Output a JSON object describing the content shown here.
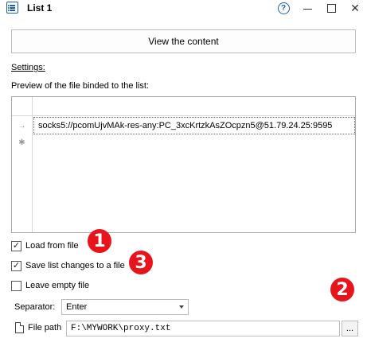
{
  "window": {
    "title": "List 1",
    "help_glyph": "?",
    "close_glyph": "✕"
  },
  "main": {
    "view_button_label": "View the content",
    "settings_label": "Settings:",
    "preview_label": "Preview of the file binded to the list:",
    "grid": {
      "rows": [
        {
          "indicator": "→",
          "value": "socks5://pcomUjvMAk-res-any:PC_3xcKrtzkAsZOcpzn5@51.79.24.25:9595"
        },
        {
          "indicator": "✱",
          "value": ""
        }
      ]
    }
  },
  "options": {
    "load_from_file": {
      "label": "Load from file",
      "checked": true
    },
    "save_changes": {
      "label": "Save list changes to a file",
      "checked": true
    },
    "leave_empty": {
      "label": "Leave empty file",
      "checked": false
    },
    "check_glyph": "✓"
  },
  "separator": {
    "label": "Separator:",
    "value": "Enter"
  },
  "file_path": {
    "label": "File path",
    "value": "F:\\MYWORK\\proxy.txt",
    "browse_label": "..."
  },
  "annotations": {
    "badge1": "1",
    "badge2": "2",
    "badge3": "3",
    "color": "#e8141b"
  }
}
